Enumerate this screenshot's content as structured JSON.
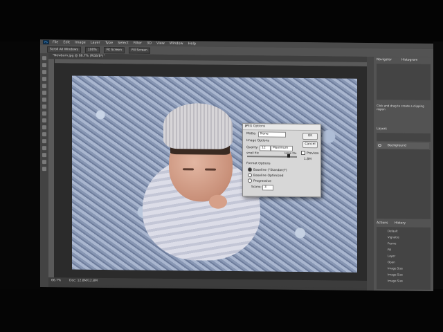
{
  "app": {
    "logo": "Ps"
  },
  "menu": [
    "File",
    "Edit",
    "Image",
    "Layer",
    "Type",
    "Select",
    "Filter",
    "3D",
    "View",
    "Window",
    "Help"
  ],
  "options_bar": [
    "Scroll All Windows",
    "100%",
    "Fit Screen",
    "Fill Screen"
  ],
  "document_tab": "\"Newborn.jpg @ 66.7% (RGB/8*)\"",
  "dialog": {
    "title": "JPEG Options",
    "close": "x",
    "matte_label": "Matte:",
    "matte_value": "None",
    "image_options": "Image Options",
    "quality_label": "Quality:",
    "quality_value": "12",
    "quality_level": "Maximum",
    "small_file": "small file",
    "large_file": "large file",
    "format_options": "Format Options",
    "format_baseline_std": "Baseline (\"Standard\")",
    "format_baseline_opt": "Baseline Optimized",
    "format_progressive": "Progressive",
    "scans_label": "Scans:",
    "scans_value": "3",
    "ok": "OK",
    "cancel": "Cancel",
    "preview": "Preview",
    "size": "1.8M"
  },
  "status": {
    "zoom": "66.7%",
    "doc": "Doc: 12.8M/12.8M"
  },
  "panels": {
    "navigator_tab": "Navigator",
    "histogram_tab": "Histogram",
    "info_text": "Click and drag to create a clipping region",
    "layers_tab": "Layers",
    "layers": [
      {
        "name": "Background"
      }
    ],
    "actions_tab": "Actions",
    "history_tab": "History",
    "actions": [
      "Default",
      "Vignette",
      "Frame",
      "Fill",
      "Layer",
      "Open",
      "Image Size",
      "Image Size",
      "Image Size"
    ]
  }
}
